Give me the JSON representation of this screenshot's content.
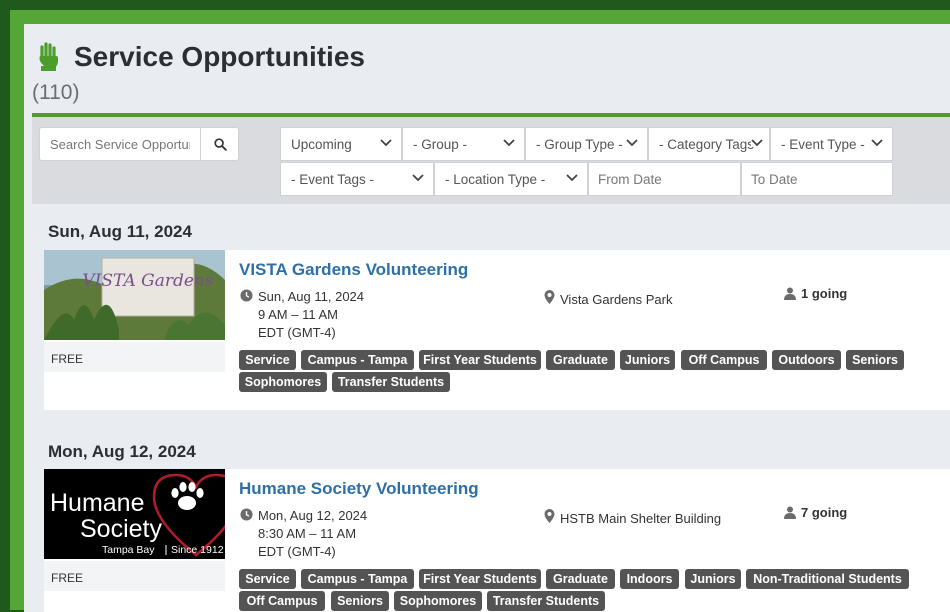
{
  "header": {
    "title": "Service Opportunities",
    "count": "(110)"
  },
  "filters": {
    "search_placeholder": "Search Service Opportunities",
    "upcoming": "Upcoming",
    "group": "- Group -",
    "group_type": "- Group Type -",
    "category_tags": "- Category Tags -",
    "event_type": "- Event Type -",
    "event_tags": "- Event Tags -",
    "location_type": "- Location Type -",
    "from_date": "From Date",
    "to_date": "To Date"
  },
  "events": [
    {
      "date_heading": "Sun, Aug 11, 2024",
      "title": "VISTA Gardens Volunteering",
      "date": "Sun, Aug 11, 2024",
      "time": "9 AM – 11 AM",
      "tz": "EDT (GMT-4)",
      "location": "Vista Gardens Park",
      "going": "1 going",
      "price": "FREE",
      "thumb_text": "VISTA Gardens",
      "tags": [
        "Service",
        "Campus - Tampa",
        "First Year Students",
        "Graduate",
        "Juniors",
        "Off Campus",
        "Outdoors",
        "Seniors",
        "Sophomores",
        "Transfer Students"
      ]
    },
    {
      "date_heading": "Mon, Aug 12, 2024",
      "title": "Humane Society Volunteering",
      "date": "Mon, Aug 12, 2024",
      "time": "8:30 AM – 11 AM",
      "tz": "EDT (GMT-4)",
      "location": "HSTB Main Shelter Building",
      "going": "7 going",
      "price": "FREE",
      "thumb_text": {
        "line1": "Humane",
        "line2": "Society",
        "line3": "Tampa Bay",
        "line4": "Since 1912"
      },
      "tags": [
        "Service",
        "Campus - Tampa",
        "First Year Students",
        "Graduate",
        "Indoors",
        "Juniors",
        "Non-Traditional Students",
        "Off Campus",
        "Seniors",
        "Sophomores",
        "Transfer Students"
      ]
    }
  ],
  "colors": {
    "accent": "#4c9d2a",
    "link": "#2f6fa7",
    "tag_bg": "#545454"
  }
}
